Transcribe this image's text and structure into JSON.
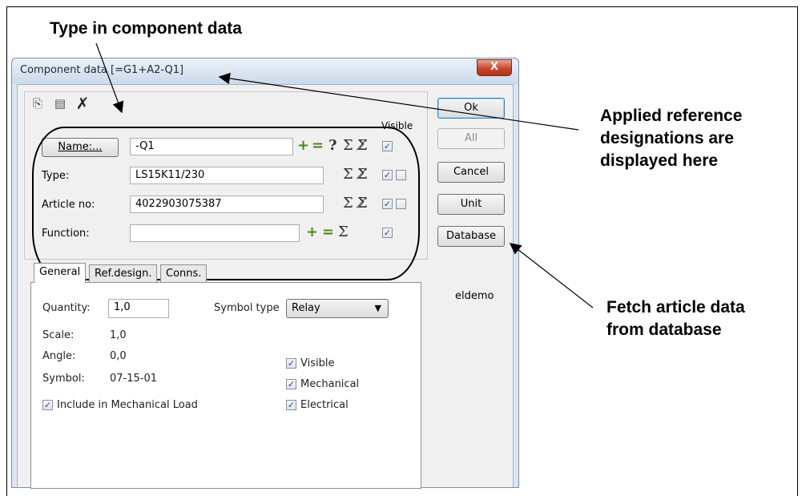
{
  "callouts": {
    "top": "Type in component data",
    "right1_line1": "Applied reference",
    "right1_line2": "designations are",
    "right1_line3": "displayed here",
    "right2_line1": "Fetch article data",
    "right2_line2": "from database"
  },
  "dialog": {
    "title": "Component data [=G1+A2-Q1]",
    "close_glyph": "X",
    "toolbar": {
      "copy_icon": "copy-icon",
      "paste_icon": "paste-icon",
      "cut_icon": "cut-icon"
    },
    "visible_header": "Visible",
    "rows": {
      "name": {
        "label": "Name:...",
        "value": "-Q1"
      },
      "type": {
        "label": "Type:",
        "value": "LS15K11/230"
      },
      "article": {
        "label": "Article no:",
        "value": "4022903075387"
      },
      "function": {
        "label": "Function:",
        "value": ""
      }
    },
    "symbols": {
      "plus": "+",
      "equals": "=",
      "question": "?",
      "sigma": "Σ",
      "sigma_check": "Σ̸"
    },
    "tabs": [
      "General",
      "Ref.design.",
      "Conns."
    ],
    "general": {
      "quantity_label": "Quantity:",
      "quantity_value": "1,0",
      "symbol_type_label": "Symbol type",
      "symbol_type_value": "Relay",
      "scale_label": "Scale:",
      "scale_value": "1,0",
      "angle_label": "Angle:",
      "angle_value": "0,0",
      "symbol_label": "Symbol:",
      "symbol_value": "07-15-01",
      "include_label": "Include in Mechanical Load",
      "visible_label": "Visible",
      "mechanical_label": "Mechanical",
      "electrical_label": "Electrical"
    },
    "buttons": {
      "ok": "Ok",
      "all": "All",
      "cancel": "Cancel",
      "unit": "Unit",
      "database": "Database"
    },
    "database_name": "eldemo"
  }
}
